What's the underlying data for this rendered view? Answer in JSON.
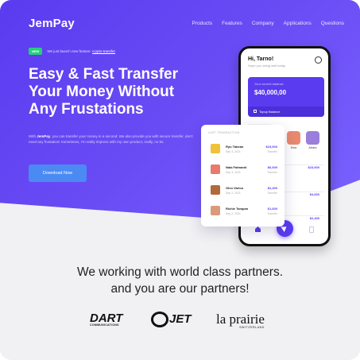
{
  "brand": {
    "logo": "JemPay"
  },
  "nav": {
    "links": [
      "Products",
      "Features",
      "Company",
      "Applications",
      "Questions"
    ]
  },
  "hero": {
    "badge": "NEW",
    "badge_text": "We just launch new feature: ",
    "badge_highlight": "crypto-transfer",
    "headline": "Easy & Fast Transfer Your Money Without Any Frustations",
    "para_prefix": "With ",
    "para_brand": "JemPay",
    "para_rest": ", you can transfer your money in a second. We also provide you with secure transfer, don't need any frustation! Sometimes, I'm really impress with my own product, really, no bs.",
    "cta": "Download Now"
  },
  "phone": {
    "greeting": "Hi, Tarno!",
    "sub": "Hope you doing well today",
    "balance_label": "Your current balance",
    "balance": "$40,000,00",
    "topup": "Topup Balance",
    "section": "RECENT PEOPLE",
    "people": [
      {
        "name": "Ema",
        "color": "#e98a6f"
      },
      {
        "name": "Almira",
        "color": "#9b7ddc"
      }
    ],
    "amounts": [
      "$23,600",
      "$4,600",
      "$2,400"
    ]
  },
  "card": {
    "title": "LAST TRANSACTION",
    "rows": [
      {
        "name": "Ryu Tabean",
        "date": "Sep 3, 2021",
        "amount": "$23,600",
        "label": "Transfer",
        "color": "#f0c23a"
      },
      {
        "name": "Nala Fatmardi",
        "date": "Sep 3, 2021",
        "amount": "$6,600",
        "label": "Transfer",
        "color": "#e87b6b"
      },
      {
        "name": "Oleo Varica",
        "date": "Sep 2, 2021",
        "amount": "$2,400",
        "label": "Transfer",
        "color": "#b06a3b"
      },
      {
        "name": "Richie Tampan",
        "date": "Sep 2, 2021",
        "amount": "$1,600",
        "label": "Transfer",
        "color": "#d99b7a"
      }
    ]
  },
  "partners": {
    "line1": "We working with world class partners.",
    "line2": "and you are our partners!",
    "logos": [
      {
        "name": "DART",
        "sub": "COMMUNICATIONS"
      },
      {
        "name": "JET"
      },
      {
        "name": "la prairie",
        "sub": "SWITZERLAND"
      }
    ]
  }
}
